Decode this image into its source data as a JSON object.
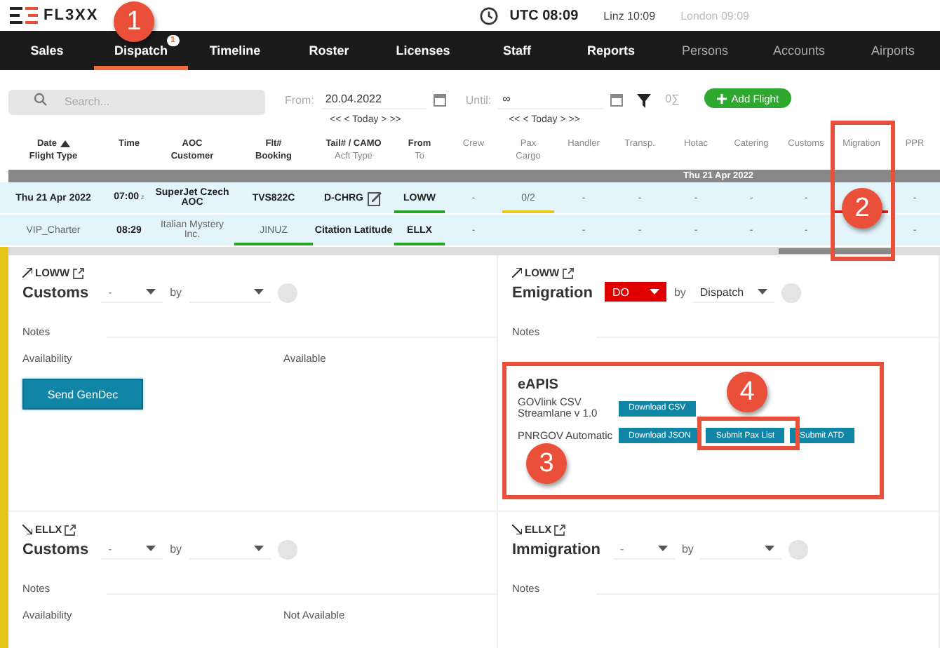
{
  "header": {
    "logo": "FL3XX",
    "utc": "UTC 08:09",
    "clocks": [
      "Linz 10:09",
      "London 09:09"
    ]
  },
  "nav": [
    {
      "label": "Sales",
      "selected": false,
      "dimmed": false
    },
    {
      "label": "Dispatch",
      "selected": true,
      "dimmed": false,
      "badge": "1"
    },
    {
      "label": "Timeline",
      "selected": false,
      "dimmed": false
    },
    {
      "label": "Roster",
      "selected": false,
      "dimmed": false
    },
    {
      "label": "Licenses",
      "selected": false,
      "dimmed": false
    },
    {
      "label": "Staff",
      "selected": false,
      "dimmed": false
    },
    {
      "label": "Reports",
      "selected": false,
      "dimmed": false
    },
    {
      "label": "Persons",
      "selected": false,
      "dimmed": true
    },
    {
      "label": "Accounts",
      "selected": false,
      "dimmed": true
    },
    {
      "label": "Airports",
      "selected": false,
      "dimmed": true
    }
  ],
  "toolbar": {
    "search_placeholder": "Search...",
    "from_label": "From:",
    "from": "20.04.2022",
    "until_label": "Until:",
    "until": "∞",
    "sum": "0∑",
    "add": "Add Flight",
    "today_links": [
      "<< < Today > >>",
      "<< < Today > >>"
    ]
  },
  "table": {
    "columns": [
      {
        "label": "Date",
        "sub": "Flight Type",
        "sorted": true
      },
      {
        "label": "Time",
        "sorted": false
      },
      {
        "label": "AOC",
        "sub": "Customer",
        "sorted": false
      },
      {
        "label": "Flt#",
        "sub": "Booking",
        "sorted": false
      },
      {
        "label": "Tail# / CAMO",
        "sub": "Acft Type",
        "sorted": false
      },
      {
        "label": "From",
        "sub": "To",
        "sorted": false
      },
      {
        "label": "Crew",
        "sorted": false
      },
      {
        "label": "Pax",
        "sub": "Cargo",
        "sorted": false
      },
      {
        "label": "Handler",
        "sorted": false
      },
      {
        "label": "Transp.",
        "sorted": false
      },
      {
        "label": "Hotac",
        "sorted": false
      },
      {
        "label": "Catering",
        "sorted": false
      },
      {
        "label": "Customs",
        "sorted": false
      },
      {
        "label": "Migration",
        "sorted": false
      },
      {
        "label": "PPR",
        "sorted": false
      }
    ],
    "date_group": "Thu 21 Apr 2022",
    "rows": [
      {
        "cells": [
          {
            "text": "Thu 21 Apr 2022",
            "bold": true
          },
          {
            "text": "07:00",
            "bold": true,
            "tz": "z"
          },
          {
            "text": "SuperJet Czech AOC",
            "bold": true
          },
          {
            "text": "TVS822C",
            "bold": true
          },
          {
            "text": "D-CHRG",
            "bold": true,
            "edit": true
          },
          {
            "text": "LOWW",
            "bold": true,
            "color": "#22a722"
          },
          {
            "text": "-",
            "bold": false
          },
          {
            "text": "0/2",
            "bold": false,
            "color": "#e8c81a"
          },
          {
            "text": "-",
            "bold": false
          },
          {
            "text": "-",
            "bold": false
          },
          {
            "text": "-",
            "bold": false
          },
          {
            "text": "-",
            "bold": false
          },
          {
            "text": "-",
            "bold": false
          },
          {
            "color": "#e02020"
          },
          {
            "text": "-",
            "bold": false
          }
        ]
      },
      {
        "cells": [
          {
            "text": "VIP_Charter",
            "bold": false
          },
          {
            "text": "08:29",
            "bold": true
          },
          {
            "text": "Italian Mystery Inc.",
            "bold": false
          },
          {
            "text": "JINUZ",
            "bold": false,
            "color": "#22a722"
          },
          {
            "text": "Citation Latitude",
            "bold": true
          },
          {
            "text": "ELLX",
            "bold": true,
            "color": "#22a722"
          },
          {
            "text": "-",
            "bold": false
          },
          {},
          {
            "text": "-",
            "bold": false
          },
          {
            "text": "-",
            "bold": false
          },
          {
            "text": "-",
            "bold": false
          },
          {
            "text": "-",
            "bold": false
          },
          {
            "text": "-",
            "bold": false
          },
          {},
          {
            "text": "-",
            "bold": false
          }
        ]
      }
    ]
  },
  "panels": [
    {
      "kind": "departure",
      "airport": "LOWW",
      "title": "Customs",
      "status": "-",
      "by_label": "by",
      "notes_label": "Notes",
      "availability_label": "Availability",
      "availability": "Available",
      "button": "Send GenDec"
    },
    {
      "kind": "departure",
      "airport": "LOWW",
      "title": "Emigration",
      "status": "DO",
      "color": "#e00000",
      "by_label": "by",
      "by": "Dispatch",
      "notes_label": "Notes",
      "eapis": {
        "title": "eAPIS",
        "lines": [
          {
            "label": "GOVlink CSV Streamlane v 1.0",
            "buttons": [
              "Download CSV"
            ]
          },
          {
            "label": "PNRGOV Automatic",
            "buttons": [
              "Download JSON",
              "Submit Pax List",
              "Submit ATD"
            ]
          }
        ]
      }
    },
    {
      "kind": "arrival",
      "airport": "ELLX",
      "title": "Customs",
      "status": "-",
      "by_label": "by",
      "notes_label": "Notes",
      "availability_label": "Availability",
      "availability": "Not Available"
    },
    {
      "kind": "arrival",
      "airport": "ELLX",
      "title": "Immigration",
      "status": "-",
      "by_label": "by",
      "notes_label": "Notes"
    }
  ],
  "callouts": [
    "1",
    "2",
    "3",
    "4"
  ]
}
